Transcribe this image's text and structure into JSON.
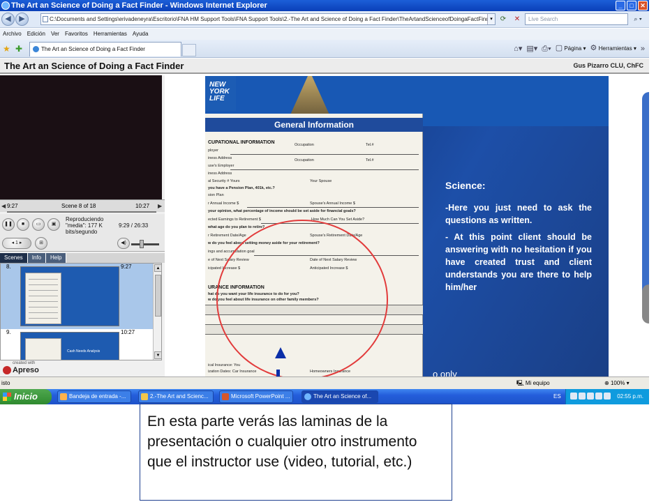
{
  "window": {
    "title": "The Art an Science of Doing a Fact Finder - Windows Internet Explorer"
  },
  "address": {
    "url": "C:\\Documents and Settings\\erivadeneyra\\Escritorio\\FNA HM Support Tools\\FNA Support Tools\\2.-The Art and Science of Doing a Fact Finder\\TheArtandScienceofDoingaFactFinde",
    "search_placeholder": "Live Search"
  },
  "menu": [
    "Archivo",
    "Edición",
    "Ver",
    "Favoritos",
    "Herramientas",
    "Ayuda"
  ],
  "tab": {
    "label": "The Art an Science of Doing a Fact Finder"
  },
  "commandbar": {
    "page": "Página",
    "tools": "Herramientas"
  },
  "presenter": {
    "title": "The Art an Science of Doing a Fact Finder",
    "presenter_name": "Gus Pizarro CLU, ChFC",
    "elapsed": "9:27",
    "scene_label": "Scene 8 of 18",
    "scene_time": "10:27",
    "status": "Reproduciendo \"media\": 177 K bits/segundo",
    "time_total": "9:29 / 26:33",
    "tabs": [
      "Scenes",
      "Info",
      "Help"
    ],
    "scenes": [
      {
        "num": "8.",
        "time": "9:27"
      },
      {
        "num": "9.",
        "time": "10:27",
        "thumb_title": "Cash Needs Analysis"
      }
    ],
    "apreso_created": "created with",
    "apreso": "Apreso"
  },
  "slide": {
    "logo": "NEW YORK LIFE",
    "form_title": "General Information",
    "sections": [
      "CUPATIONAL INFORMATION",
      "URANCE INFORMATION"
    ],
    "lines": [
      "ployer",
      "iness Address",
      "use's Employer",
      "iness Address",
      "al Security #  Yours",
      "you have a Pension Plan, 401k, etc.?",
      "sion Plan",
      "r Annual Income  $",
      "your opinion, what percentage of income should be set aside for financial goals?",
      "ected Earnings to Retirement  $",
      "what age do you plan to retire?",
      "r Retirement Date/Age",
      "w do you feel about setting money aside for your retirement?",
      "ings and accumulation goal",
      "e of Next Salary Review",
      "icipated Increase  $",
      "hat do you want your life insurance to do for you?",
      "w do you feel about life insurance on other family members?",
      "ical Insurance: You",
      "ization Dates: Car Insurance"
    ],
    "right_fields": [
      "Occupation",
      "Tel.#",
      "Occupation",
      "Tel.#",
      "Your Spouse",
      "Spouse's Annual Income  $",
      "How Much Can You Set Aside?",
      "Spouse's Retirement Date/Age",
      "Date of Next Salary Review",
      "Anticipated Increase  $",
      "Homeowners Insurance"
    ],
    "heading": "Science:",
    "points": [
      "-Here you just need to ask the questions as written.",
      "- At this point client should be answering with no hesitation if you have created trust and client understands you are there to help him/her"
    ],
    "footer": "o only"
  },
  "statusbar": {
    "left": "isto",
    "zone": "Mi equipo",
    "zoom": "100%"
  },
  "taskbar": {
    "start": "Inicio",
    "tasks": [
      "Bandeja de entrada -...",
      "2.-The Art and Scienc...",
      "Microsoft PowerPoint ...",
      "The Art an Science of..."
    ],
    "lang": "ES",
    "clock": "02:55 p.m."
  },
  "callout": {
    "text": "En esta parte verás las laminas de la presentación o cualquier otro instrumento que el instructor use (video, tutorial, etc.)"
  }
}
